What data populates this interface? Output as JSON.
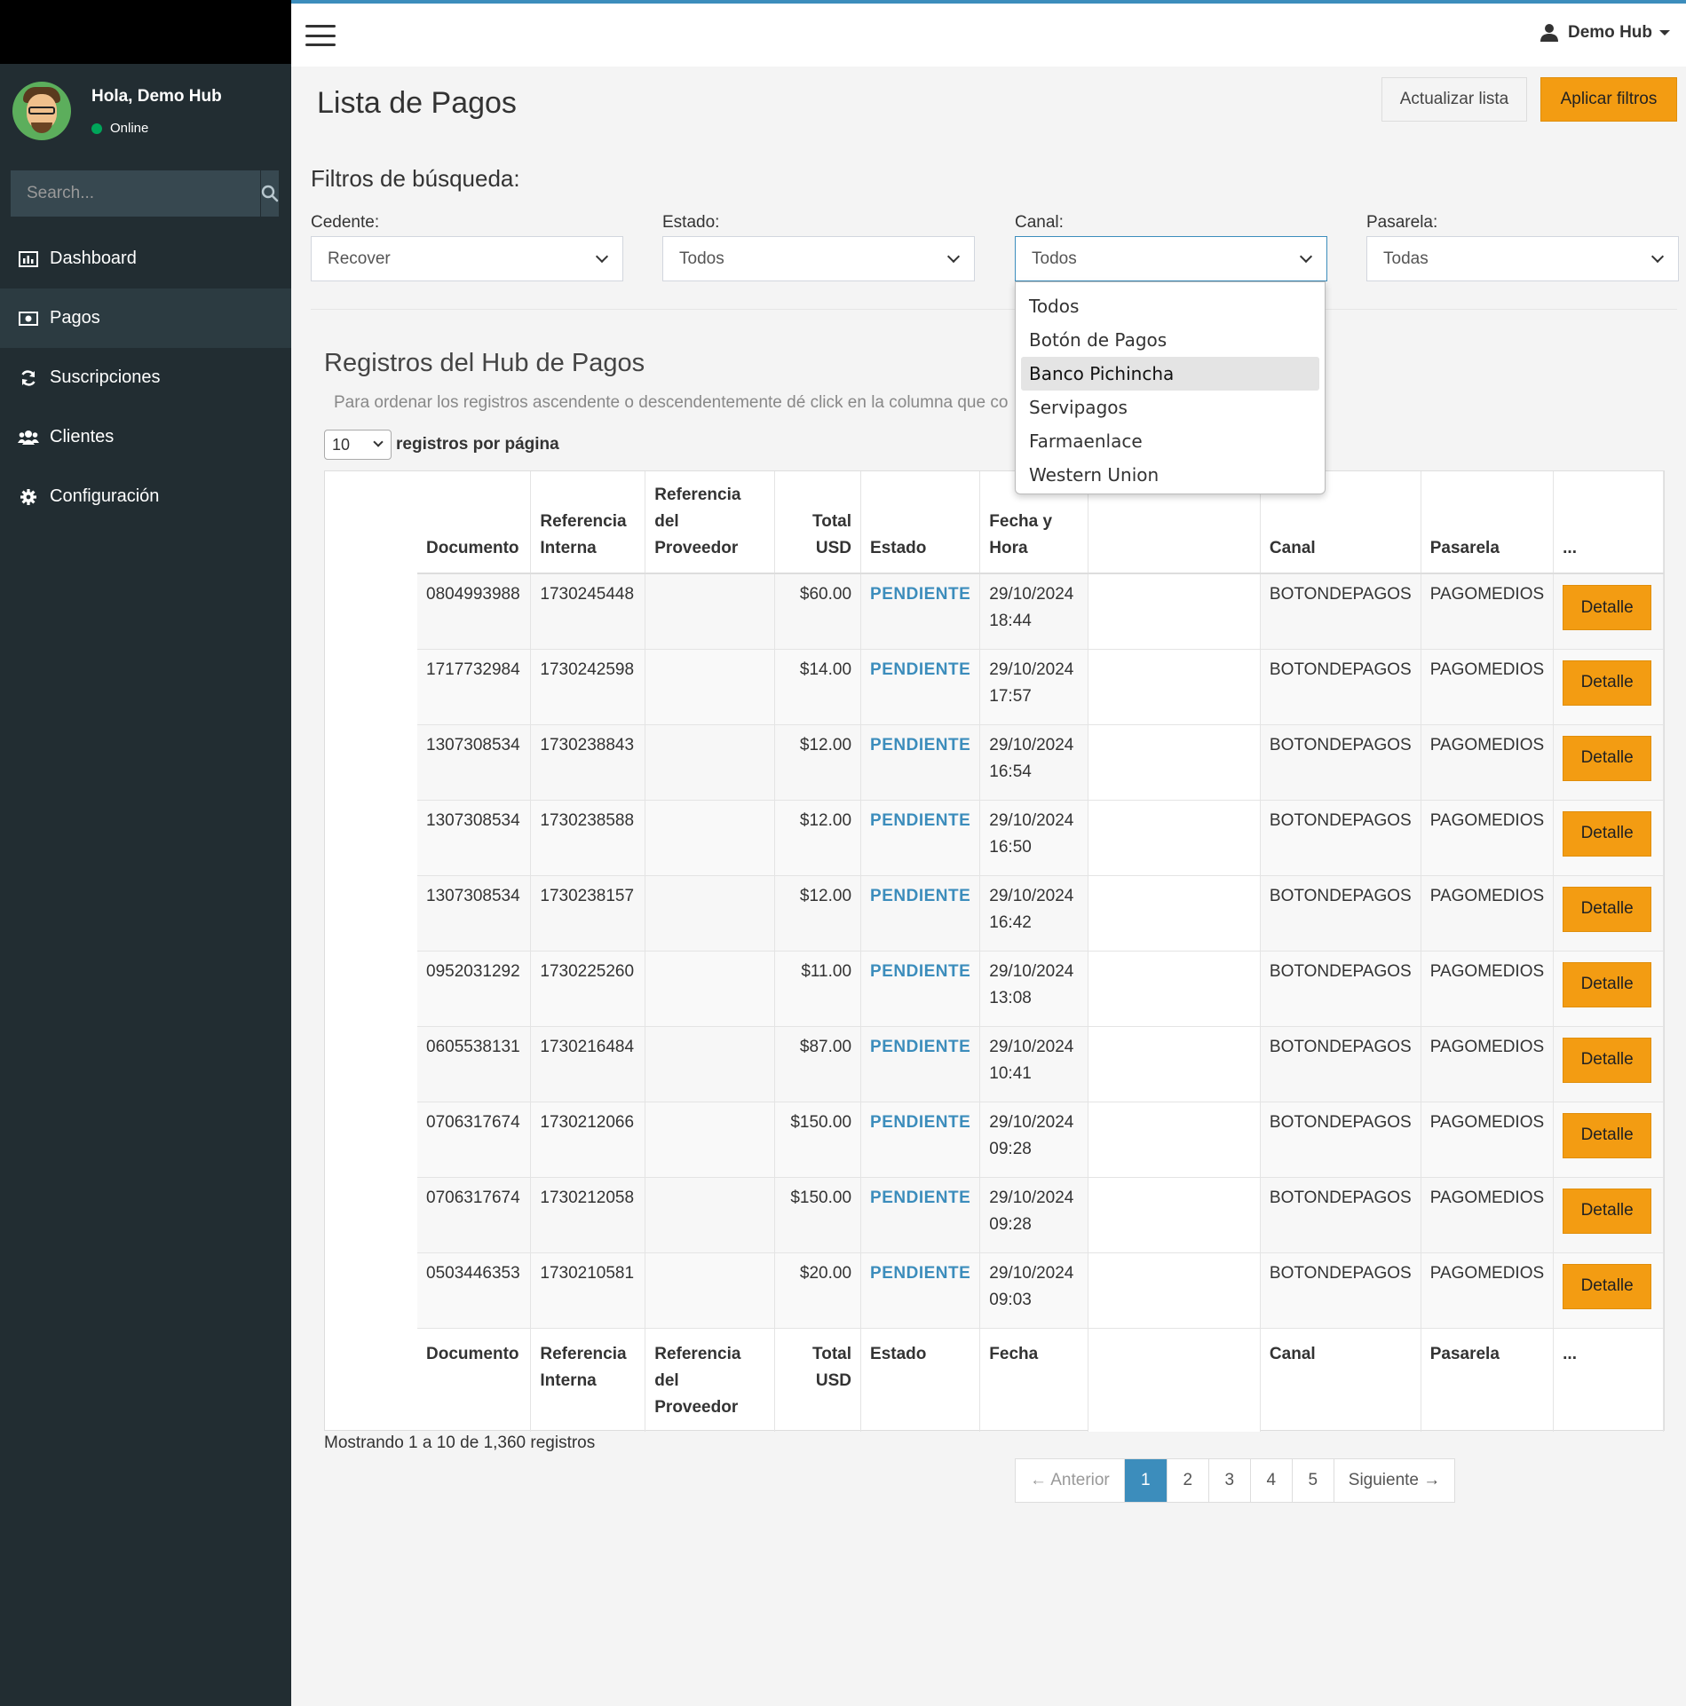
{
  "user": {
    "greeting": "Hola, Demo Hub",
    "status": "Online",
    "topbar_name": "Demo Hub"
  },
  "sidebar": {
    "search_placeholder": "Search...",
    "items": [
      {
        "label": "Dashboard",
        "icon": "bar-chart-icon"
      },
      {
        "label": "Pagos",
        "icon": "money-icon",
        "active": true
      },
      {
        "label": "Suscripciones",
        "icon": "refresh-icon"
      },
      {
        "label": "Clientes",
        "icon": "users-icon"
      },
      {
        "label": "Configuración",
        "icon": "gear-icon"
      }
    ]
  },
  "header": {
    "title": "Lista de Pagos",
    "refresh_label": "Actualizar lista",
    "apply_label": "Aplicar filtros"
  },
  "filters": {
    "title": "Filtros de búsqueda:",
    "cedente": {
      "label": "Cedente:",
      "value": "Recover"
    },
    "estado": {
      "label": "Estado:",
      "value": "Todos"
    },
    "canal": {
      "label": "Canal:",
      "value": "Todos",
      "options": [
        "Todos",
        "Botón de Pagos",
        "Banco Pichincha",
        "Servipagos",
        "Farmaenlace",
        "Western Union"
      ],
      "highlighted": "Banco Pichincha"
    },
    "pasarela": {
      "label": "Pasarela:",
      "value": "Todas"
    }
  },
  "records": {
    "title": "Registros del Hub de Pagos",
    "hint": "Para ordenar los registros ascendente o descendentemente dé click en la columna que co",
    "page_length": "10",
    "page_length_label": "registros por página",
    "header": {
      "documento": "Documento",
      "ref_interna": "Referencia Interna",
      "ref_proveedor": "Referencia del Proveedor",
      "total": "Total USD",
      "estado": "Estado",
      "fecha": "Fecha y Hora",
      "canal": "Canal",
      "pasarela": "Pasarela",
      "more": "..."
    },
    "footer": {
      "documento": "Documento",
      "ref_interna": "Referencia Interna",
      "ref_proveedor": "Referencia del Proveedor",
      "total": "Total USD",
      "estado": "Estado",
      "fecha": "Fecha",
      "canal": "Canal",
      "pasarela": "Pasarela",
      "more": "..."
    },
    "detail_label": "Detalle",
    "rows": [
      {
        "documento": "0804993988",
        "ref": "1730245448",
        "total": "$60.00",
        "estado": "PENDIENTE",
        "fecha": "29/10/2024",
        "hora": "18:44",
        "canal": "BOTONDEPAGOS",
        "pasarela": "PAGOMEDIOS"
      },
      {
        "documento": "1717732984",
        "ref": "1730242598",
        "total": "$14.00",
        "estado": "PENDIENTE",
        "fecha": "29/10/2024",
        "hora": "17:57",
        "canal": "BOTONDEPAGOS",
        "pasarela": "PAGOMEDIOS"
      },
      {
        "documento": "1307308534",
        "ref": "1730238843",
        "total": "$12.00",
        "estado": "PENDIENTE",
        "fecha": "29/10/2024",
        "hora": "16:54",
        "canal": "BOTONDEPAGOS",
        "pasarela": "PAGOMEDIOS"
      },
      {
        "documento": "1307308534",
        "ref": "1730238588",
        "total": "$12.00",
        "estado": "PENDIENTE",
        "fecha": "29/10/2024",
        "hora": "16:50",
        "canal": "BOTONDEPAGOS",
        "pasarela": "PAGOMEDIOS"
      },
      {
        "documento": "1307308534",
        "ref": "1730238157",
        "total": "$12.00",
        "estado": "PENDIENTE",
        "fecha": "29/10/2024",
        "hora": "16:42",
        "canal": "BOTONDEPAGOS",
        "pasarela": "PAGOMEDIOS"
      },
      {
        "documento": "0952031292",
        "ref": "1730225260",
        "total": "$11.00",
        "estado": "PENDIENTE",
        "fecha": "29/10/2024",
        "hora": "13:08",
        "canal": "BOTONDEPAGOS",
        "pasarela": "PAGOMEDIOS"
      },
      {
        "documento": "0605538131",
        "ref": "1730216484",
        "total": "$87.00",
        "estado": "PENDIENTE",
        "fecha": "29/10/2024",
        "hora": "10:41",
        "canal": "BOTONDEPAGOS",
        "pasarela": "PAGOMEDIOS"
      },
      {
        "documento": "0706317674",
        "ref": "1730212066",
        "total": "$150.00",
        "estado": "PENDIENTE",
        "fecha": "29/10/2024",
        "hora": "09:28",
        "canal": "BOTONDEPAGOS",
        "pasarela": "PAGOMEDIOS"
      },
      {
        "documento": "0706317674",
        "ref": "1730212058",
        "total": "$150.00",
        "estado": "PENDIENTE",
        "fecha": "29/10/2024",
        "hora": "09:28",
        "canal": "BOTONDEPAGOS",
        "pasarela": "PAGOMEDIOS"
      },
      {
        "documento": "0503446353",
        "ref": "1730210581",
        "total": "$20.00",
        "estado": "PENDIENTE",
        "fecha": "29/10/2024",
        "hora": "09:03",
        "canal": "BOTONDEPAGOS",
        "pasarela": "PAGOMEDIOS"
      }
    ],
    "info": "Mostrando 1 a 10 de 1,360 registros"
  },
  "pagination": {
    "prev": "← Anterior",
    "pages": [
      "1",
      "2",
      "3",
      "4",
      "5"
    ],
    "active": "1",
    "next": "Siguiente →"
  },
  "colors": {
    "accent": "#3c8dbc",
    "warning": "#f39c12",
    "sidebar": "#222d32"
  }
}
